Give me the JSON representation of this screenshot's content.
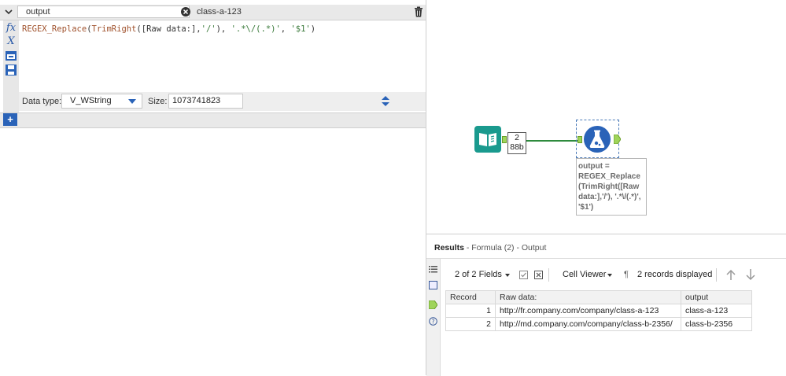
{
  "formula_editor": {
    "output_field": "output",
    "preview_value": "class-a-123",
    "expression": {
      "function_1": "REGEX_Replace",
      "function_2": "TrimRight",
      "field": "[Raw data:]",
      "arg_1": "'/'",
      "arg_2": "'.*\\/(.*)'",
      "arg_3": "'$1'"
    },
    "data_type_label": "Data type:",
    "data_type_value": "V_WString",
    "size_label": "Size:",
    "size_value": "1073741823",
    "toolbar_icons": [
      "fx-icon",
      "variable-icon",
      "saved-expressions-icon",
      "save-icon"
    ]
  },
  "canvas": {
    "record_count": "2",
    "record_size": "88b",
    "annotation": "output = REGEX_Replace (TrimRight([Raw data:],'/'), '.*\\/(.*)', '$1')"
  },
  "results": {
    "title": "Results",
    "breadcrumb": "- Formula (2) - Output",
    "fields_selector": "2 of 2 Fields",
    "cell_viewer": "Cell Viewer",
    "records_displayed": "2 records displayed",
    "columns": [
      "Record",
      "Raw data:",
      "output"
    ],
    "rows": [
      {
        "record": "1",
        "raw": "http://fr.company.com/company/class-a-123",
        "output": "class-a-123"
      },
      {
        "record": "2",
        "raw": "http://md.company.com/company/class-b-2356/",
        "output": "class-b-2356"
      }
    ]
  },
  "colors": {
    "accent_blue": "#2a63b8",
    "input_tool_teal": "#1a9a8e",
    "connector_green": "#2e8b3e"
  }
}
